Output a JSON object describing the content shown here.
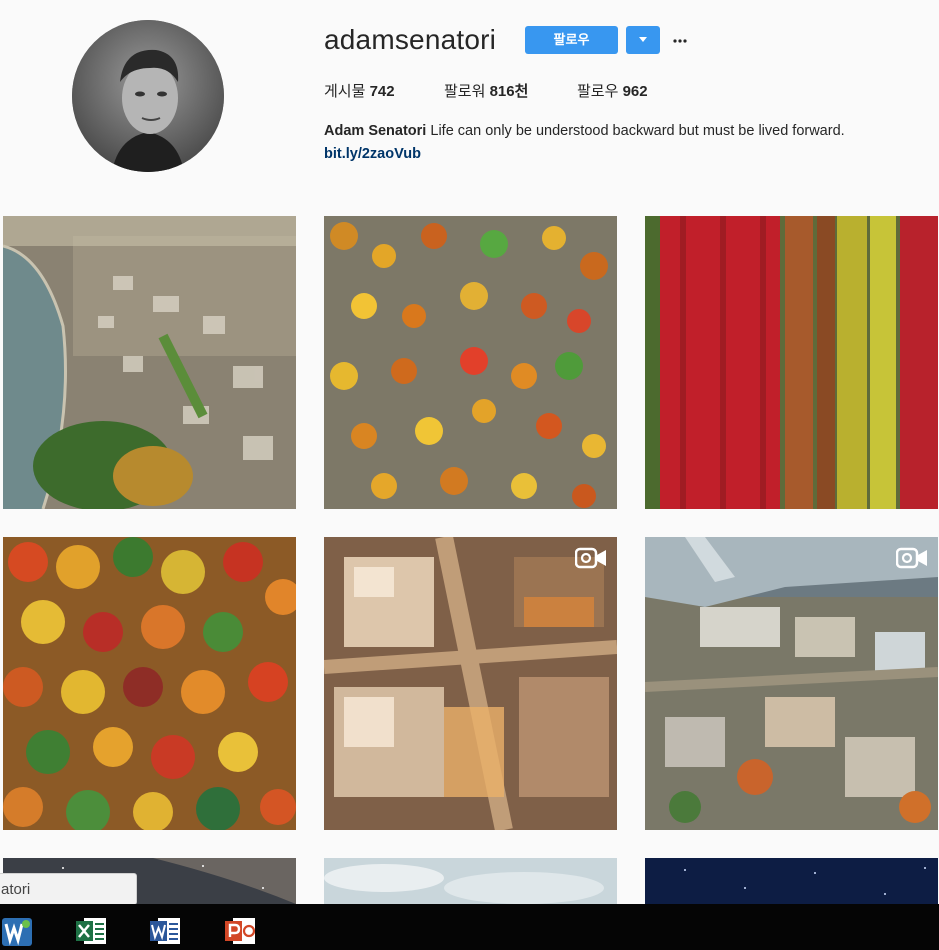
{
  "profile": {
    "username": "adamsenatori",
    "follow_label": "팔로우",
    "stats": {
      "posts_label": "게시물",
      "posts_value": "742",
      "followers_label": "팔로워",
      "followers_value": "816천",
      "following_label": "팔로우",
      "following_value": "962"
    },
    "bio_name": "Adam Senatori",
    "bio_text": "Life can only be understood backward but must be lived forward.",
    "link": "bit.ly/2zaoVub"
  },
  "posts": [
    {
      "subject": "aerial-city-lake",
      "video": false
    },
    {
      "subject": "aerial-autumn-forest",
      "video": false
    },
    {
      "subject": "red-tree-rows",
      "video": false
    },
    {
      "subject": "autumn-treetops",
      "video": false
    },
    {
      "subject": "downtown-aerial",
      "video": true
    },
    {
      "subject": "wing-over-city",
      "video": true
    },
    {
      "subject": "milky-way",
      "video": false
    },
    {
      "subject": "sky-clouds",
      "video": false
    },
    {
      "subject": "night-stars",
      "video": false
    }
  ],
  "tooltip": {
    "text": "atori"
  },
  "taskbar": {
    "apps": [
      "wordpad-icon",
      "excel-icon",
      "word-icon",
      "powerpoint-icon"
    ]
  },
  "colors": {
    "accent": "#3897f0",
    "link": "#003569",
    "text": "#262626"
  }
}
